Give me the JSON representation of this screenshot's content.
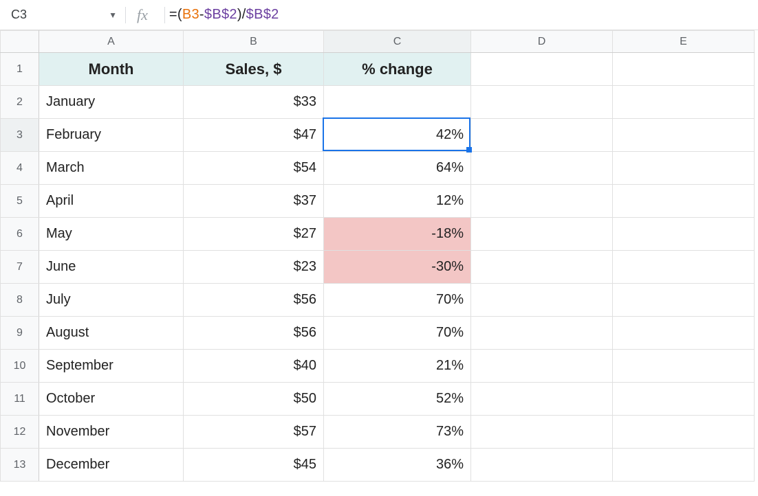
{
  "nameBox": {
    "value": "C3"
  },
  "formulaBar": {
    "eq": "=",
    "lpar": "(",
    "refRel": "B3",
    "minus": "-",
    "refAbs1": "$B$2",
    "rpar": ")",
    "slash": "/",
    "refAbs2": "$B$2"
  },
  "columns": [
    "A",
    "B",
    "C",
    "D",
    "E"
  ],
  "rowNums": [
    "1",
    "2",
    "3",
    "4",
    "5",
    "6",
    "7",
    "8",
    "9",
    "10",
    "11",
    "12",
    "13"
  ],
  "headers": {
    "A": "Month",
    "B": "Sales, $",
    "C": "% change"
  },
  "rows": [
    {
      "month": "January",
      "sales": "$33",
      "pct": "",
      "neg": false
    },
    {
      "month": "February",
      "sales": "$47",
      "pct": "42%",
      "neg": false
    },
    {
      "month": "March",
      "sales": "$54",
      "pct": "64%",
      "neg": false
    },
    {
      "month": "April",
      "sales": "$37",
      "pct": "12%",
      "neg": false
    },
    {
      "month": "May",
      "sales": "$27",
      "pct": "-18%",
      "neg": true
    },
    {
      "month": "June",
      "sales": "$23",
      "pct": "-30%",
      "neg": true
    },
    {
      "month": "July",
      "sales": "$56",
      "pct": "70%",
      "neg": false
    },
    {
      "month": "August",
      "sales": "$56",
      "pct": "70%",
      "neg": false
    },
    {
      "month": "September",
      "sales": "$40",
      "pct": "21%",
      "neg": false
    },
    {
      "month": "October",
      "sales": "$50",
      "pct": "52%",
      "neg": false
    },
    {
      "month": "November",
      "sales": "$57",
      "pct": "73%",
      "neg": false
    },
    {
      "month": "December",
      "sales": "$45",
      "pct": "36%",
      "neg": false
    }
  ],
  "activeCell": {
    "col": "C",
    "row": 3
  },
  "chart_data": {
    "type": "table",
    "title": "Monthly sales and percent change vs January",
    "columns": [
      "Month",
      "Sales, $",
      "% change"
    ],
    "series": [
      {
        "name": "Sales, $",
        "categories": [
          "January",
          "February",
          "March",
          "April",
          "May",
          "June",
          "July",
          "August",
          "September",
          "October",
          "November",
          "December"
        ],
        "values": [
          33,
          47,
          54,
          37,
          27,
          23,
          56,
          56,
          40,
          50,
          57,
          45
        ]
      },
      {
        "name": "% change",
        "categories": [
          "February",
          "March",
          "April",
          "May",
          "June",
          "July",
          "August",
          "September",
          "October",
          "November",
          "December"
        ],
        "values": [
          42,
          64,
          12,
          -18,
          -30,
          70,
          70,
          21,
          52,
          73,
          36
        ]
      }
    ]
  }
}
